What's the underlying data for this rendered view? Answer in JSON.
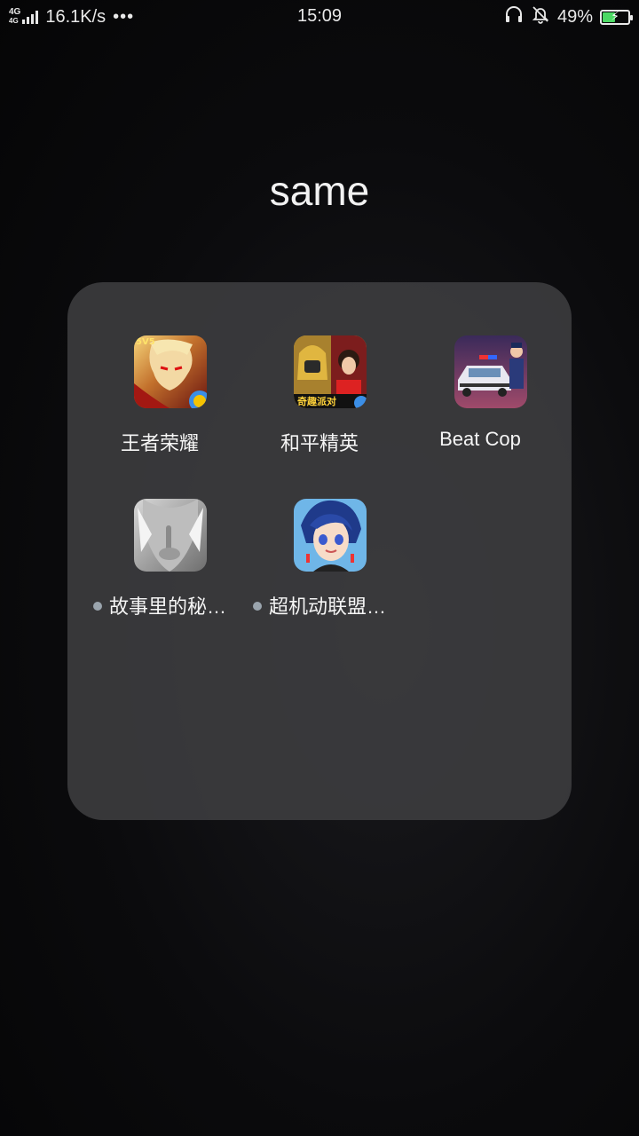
{
  "status_bar": {
    "network_type_top": "4G",
    "network_type_sub": "4G",
    "net_speed": "16.1K/s",
    "more": "•••",
    "time": "15:09",
    "battery_percent": "49%",
    "battery_level": 0.49,
    "icons": [
      "signal-icon",
      "headphones-icon",
      "bell-muted-icon",
      "battery-charging-icon"
    ]
  },
  "folder": {
    "title": "same",
    "apps": [
      {
        "label": "王者荣耀",
        "icon": "honor-of-kings-icon",
        "has_new_badge": false
      },
      {
        "label": "和平精英",
        "icon": "peacekeeper-elite-icon",
        "has_new_badge": false
      },
      {
        "label": "Beat Cop",
        "icon": "beat-cop-icon",
        "has_new_badge": false
      },
      {
        "label": "故事里的秘…",
        "icon": "story-secret-icon",
        "has_new_badge": true
      },
      {
        "label": "超机动联盟…",
        "icon": "super-mecha-league-icon",
        "has_new_badge": true
      }
    ]
  },
  "colors": {
    "panel_bg": "#3e3e40",
    "badge_dot": "#9aa4ad",
    "battery_fill": "#4cd964"
  }
}
